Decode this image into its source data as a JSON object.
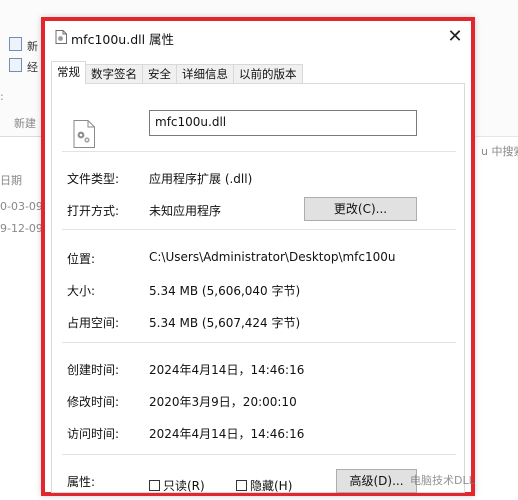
{
  "background": {
    "ribbon": [
      "新",
      "经",
      "新建"
    ],
    "column_header": "日期",
    "rows": [
      "0-03-09",
      "9-12-09"
    ],
    "search_hint": "u 中搜索"
  },
  "dialog": {
    "title": "mfc100u.dll 属性",
    "close_symbol": "✕",
    "tabs": [
      "常规",
      "数字签名",
      "安全",
      "详细信息",
      "以前的版本"
    ],
    "active_tab": "常规",
    "file_name": "mfc100u.dll",
    "file_type_label": "文件类型:",
    "file_type_value": "应用程序扩展 (.dll)",
    "opens_with_label": "打开方式:",
    "opens_with_value": "未知应用程序",
    "change_button": "更改(C)...",
    "location_label": "位置:",
    "location_value": "C:\\Users\\Administrator\\Desktop\\mfc100u",
    "size_label": "大小:",
    "size_value": "5.34 MB (5,606,040 字节)",
    "size_on_disk_label": "占用空间:",
    "size_on_disk_value": "5.34 MB (5,607,424 字节)",
    "created_label": "创建时间:",
    "created_value": "2024年4月14日，14:46:16",
    "modified_label": "修改时间:",
    "modified_value": "2020年3月9日，20:00:10",
    "accessed_label": "访问时间:",
    "accessed_value": "2024年4月14日，14:46:16",
    "attributes_label": "属性:",
    "readonly_label": "只读(R)",
    "hidden_label": "隐藏(H)",
    "advanced_button": "高级(D)..."
  },
  "watermark": "电脑技术DLL",
  "colors": {
    "highlight_border": "#e3262e",
    "button_face": "#e1e1e1",
    "tab_inactive": "#f0f0f0"
  },
  "icons": [
    "dll-file-icon",
    "gear-file-icon",
    "close-icon",
    "checkbox-icon"
  ]
}
